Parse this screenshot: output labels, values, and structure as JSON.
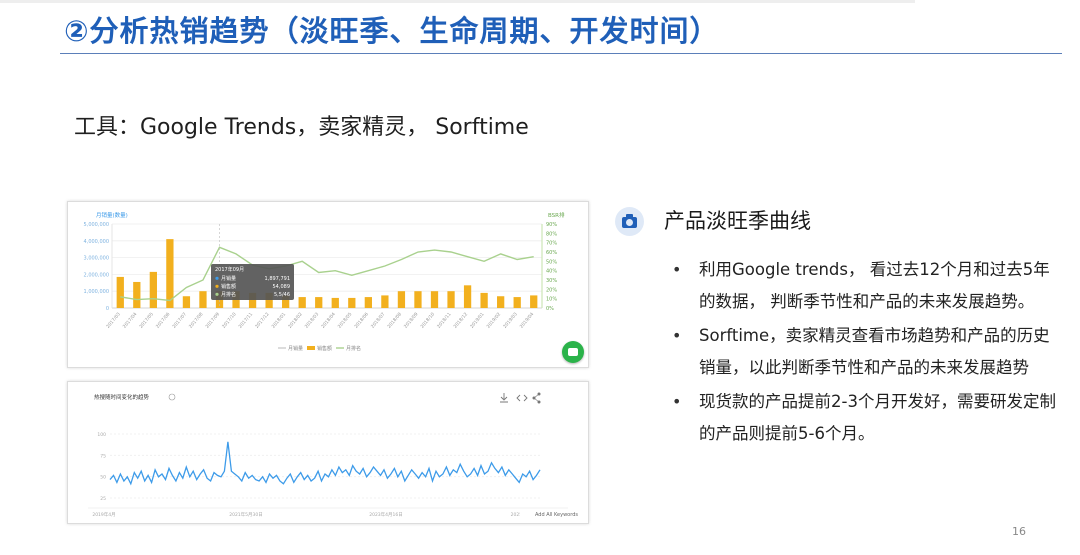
{
  "slide": {
    "title": "②分析热销趋势（淡旺季、生命周期、开发时间）",
    "tools_line": "工具：Google Trends，卖家精灵， Sorftime",
    "page_number": "16",
    "accent_color": "#1f5fb8"
  },
  "right": {
    "section_title": "产品淡旺季曲线",
    "icon": "camera-icon",
    "bullets": [
      "利用Google trends， 看过去12个月和过去5年的数据， 判断季节性和产品的未来发展趋势。",
      "Sorftime，卖家精灵查看市场趋势和产品的历史销量，以此判断季节性和产品的未来发展趋势",
      "现货款的产品提前2-3个月开发好，需要研发定制的产品则提前5-6个月。"
    ]
  },
  "chart_data": [
    {
      "type": "bar",
      "title": "",
      "ylabel": "月销量(数量)",
      "y2label": "BSR排",
      "ylim": [
        0,
        5000000
      ],
      "y2lim": [
        0,
        90
      ],
      "yticks": [
        "5,000,000",
        "4,000,000",
        "3,000,000",
        "2,000,000",
        "1,000,000",
        "0"
      ],
      "y2ticks": [
        "90%",
        "80%",
        "70%",
        "60%",
        "50%",
        "40%",
        "30%",
        "20%",
        "10%",
        "0%"
      ],
      "categories": [
        "2017/03",
        "2017/04",
        "2017/05",
        "2017/06",
        "2017/07",
        "2017/08",
        "2017/09",
        "2017/10",
        "2017/11",
        "2017/12",
        "2018/01",
        "2018/02",
        "2018/03",
        "2018/04",
        "2018/05",
        "2018/06",
        "2018/07",
        "2018/08",
        "2018/09",
        "2018/10",
        "2018/11",
        "2018/12",
        "2019/01",
        "2019/02",
        "2019/03",
        "2019/04"
      ],
      "legend": [
        "月销量",
        "销售额",
        "月排名"
      ],
      "legend_position": "bottom",
      "series": [
        {
          "name": "销售额",
          "kind": "bar",
          "color": "#f2b01e",
          "values": [
            1850000,
            1550000,
            2150000,
            4100000,
            700000,
            1000000,
            1000000,
            1000000,
            900000,
            900000,
            750000,
            650000,
            650000,
            600000,
            600000,
            650000,
            750000,
            1000000,
            1000000,
            1000000,
            1000000,
            1350000,
            900000,
            700000,
            650000,
            750000
          ]
        },
        {
          "name": "月排名",
          "kind": "line",
          "axis": "right",
          "color": "#a9d18e",
          "values": [
            12,
            9,
            10,
            8,
            22,
            30,
            65,
            58,
            46,
            42,
            45,
            50,
            38,
            40,
            35,
            40,
            45,
            52,
            60,
            62,
            60,
            55,
            50,
            58,
            52,
            55
          ]
        }
      ],
      "tooltip": {
        "title": "2017年09月",
        "rows": [
          {
            "label": "月销量",
            "value": "1,897,791"
          },
          {
            "label": "销售额",
            "value": "54,089"
          },
          {
            "label": "月排名",
            "value": "5,5/46"
          }
        ]
      },
      "grid": true
    },
    {
      "type": "line",
      "title": "热搜随时间变化的趋势",
      "x_labels": [
        "2019年4月",
        "2021年5月30日",
        "2023年4月16日",
        "2025年3月2日"
      ],
      "yticks": [
        "100",
        "75",
        "50",
        "25"
      ],
      "ylim": [
        0,
        100
      ],
      "footer_link": "Add All Keywords",
      "series": [
        {
          "name": "热度",
          "color": "#3d9be9",
          "values": [
            32,
            38,
            28,
            40,
            30,
            36,
            26,
            42,
            34,
            44,
            30,
            38,
            28,
            46,
            36,
            40,
            32,
            48,
            38,
            30,
            42,
            34,
            50,
            36,
            44,
            32,
            40,
            46,
            34,
            30,
            42,
            38,
            36,
            44,
            86,
            44,
            40,
            36,
            30,
            42,
            34,
            38,
            32,
            30,
            36,
            28,
            40,
            34,
            38,
            30,
            26,
            34,
            40,
            28,
            36,
            42,
            32,
            38,
            30,
            34,
            44,
            30,
            40,
            36,
            46,
            38,
            50,
            42,
            46,
            38,
            52,
            44,
            40,
            48,
            36,
            42,
            50,
            44,
            38,
            46,
            34,
            40,
            48,
            36,
            44,
            30,
            38,
            46,
            40,
            34,
            42,
            36,
            48,
            30,
            44,
            36,
            40,
            50,
            38,
            46,
            42,
            54,
            44,
            36,
            40,
            48,
            38,
            52,
            40,
            44,
            56,
            48,
            42,
            50,
            38,
            46,
            40,
            34,
            28,
            40,
            36,
            44,
            32,
            38,
            46
          ]
        }
      ],
      "toolbar_icons": [
        "download-icon",
        "embed-icon",
        "share-icon"
      ],
      "grid": true
    }
  ]
}
